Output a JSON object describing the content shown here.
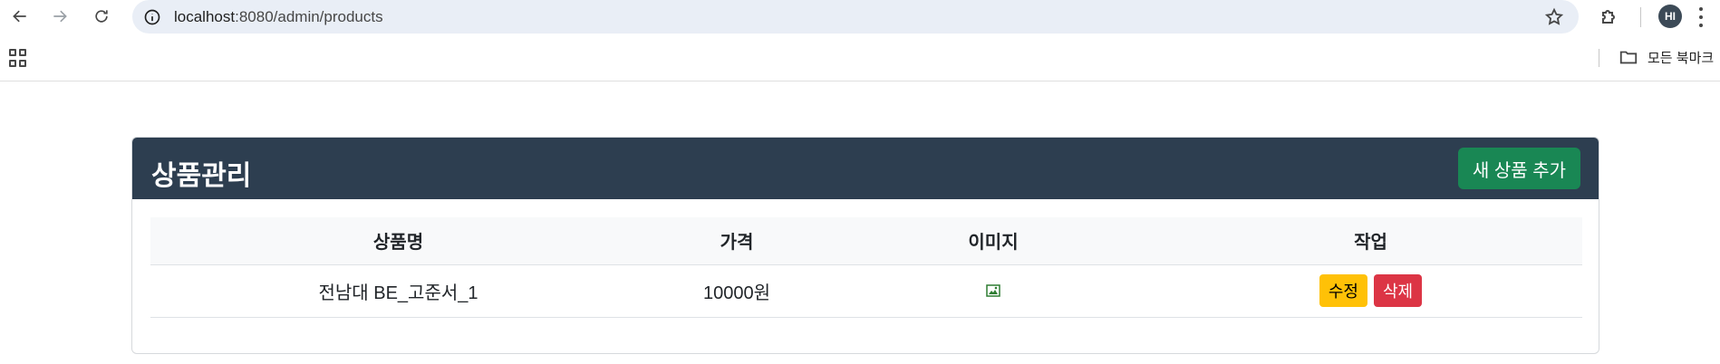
{
  "browser": {
    "url_host": "localhost",
    "url_path": ":8080/admin/products",
    "profile_initials": "HI",
    "bookmarks_label": "모든 북마크"
  },
  "page": {
    "title": "상품관리",
    "add_button_label": "새 상품 추가",
    "table": {
      "headers": [
        "상품명",
        "가격",
        "이미지",
        "작업"
      ],
      "rows": [
        {
          "name": "전남대 BE_고준서_1",
          "price": "10000원",
          "image": "broken-image-icon",
          "edit_label": "수정",
          "delete_label": "삭제"
        }
      ]
    }
  },
  "colors": {
    "header_bg": "#2d3e50",
    "add_button": "#198754",
    "edit_button": "#ffc107",
    "delete_button": "#dc3545"
  }
}
